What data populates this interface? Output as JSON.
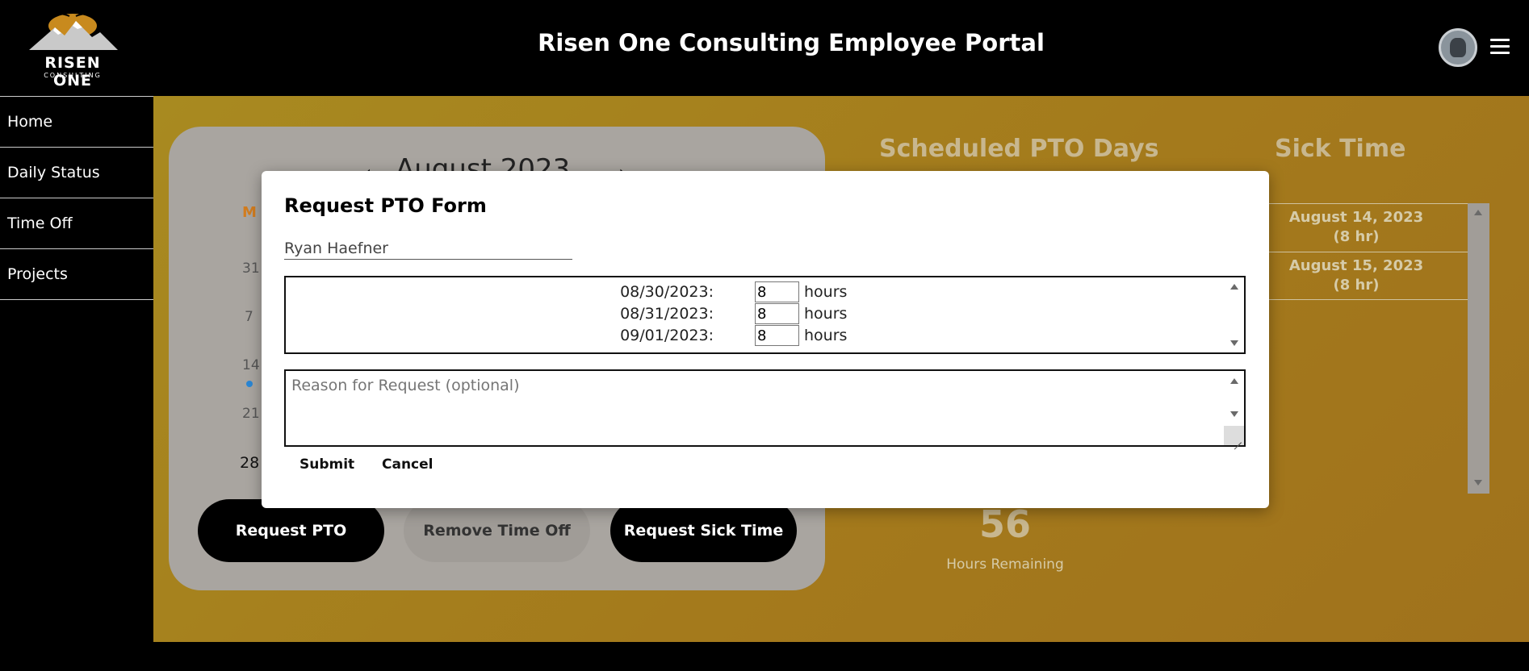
{
  "header": {
    "logo_text": "RISEN ONE",
    "logo_sub": "CONSULTING",
    "title": "Risen One Consulting Employee Portal",
    "avatar_icon": "user-avatar-icon",
    "menu_icon": "hamburger-menu-icon"
  },
  "sidebar": {
    "items": [
      {
        "label": "Home"
      },
      {
        "label": "Daily Status"
      },
      {
        "label": "Time Off"
      },
      {
        "label": "Projects"
      }
    ]
  },
  "calendar": {
    "month": "August 2023",
    "weekday_first": "M",
    "visible_numbers": [
      "31",
      "7",
      "14",
      "21",
      "28"
    ]
  },
  "actions": {
    "request_pto": "Request PTO",
    "remove_time_off": "Remove Time Off",
    "request_sick_time": "Request Sick Time"
  },
  "pto": {
    "title": "Scheduled PTO Days",
    "hours_remaining": "56",
    "hours_label": "Hours Remaining"
  },
  "sick": {
    "title": "Sick Time",
    "entries": [
      {
        "date": "August 14, 2023",
        "hours": "(8 hr)"
      },
      {
        "date": "August 15, 2023",
        "hours": "(8 hr)"
      }
    ]
  },
  "modal": {
    "title": "Request PTO Form",
    "employee_name": "Ryan Haefner",
    "dates": [
      {
        "date": "08/30/2023:",
        "hours": "8",
        "unit": "hours"
      },
      {
        "date": "08/31/2023:",
        "hours": "8",
        "unit": "hours"
      },
      {
        "date": "09/01/2023:",
        "hours": "8",
        "unit": "hours"
      }
    ],
    "reason_placeholder": "Reason for Request (optional)",
    "submit": "Submit",
    "cancel": "Cancel"
  },
  "colors": {
    "accent_gold": "#a88a20",
    "calendar_card": "#a9a5a0",
    "button_dark": "#000000",
    "button_muted": "#a09c97"
  }
}
